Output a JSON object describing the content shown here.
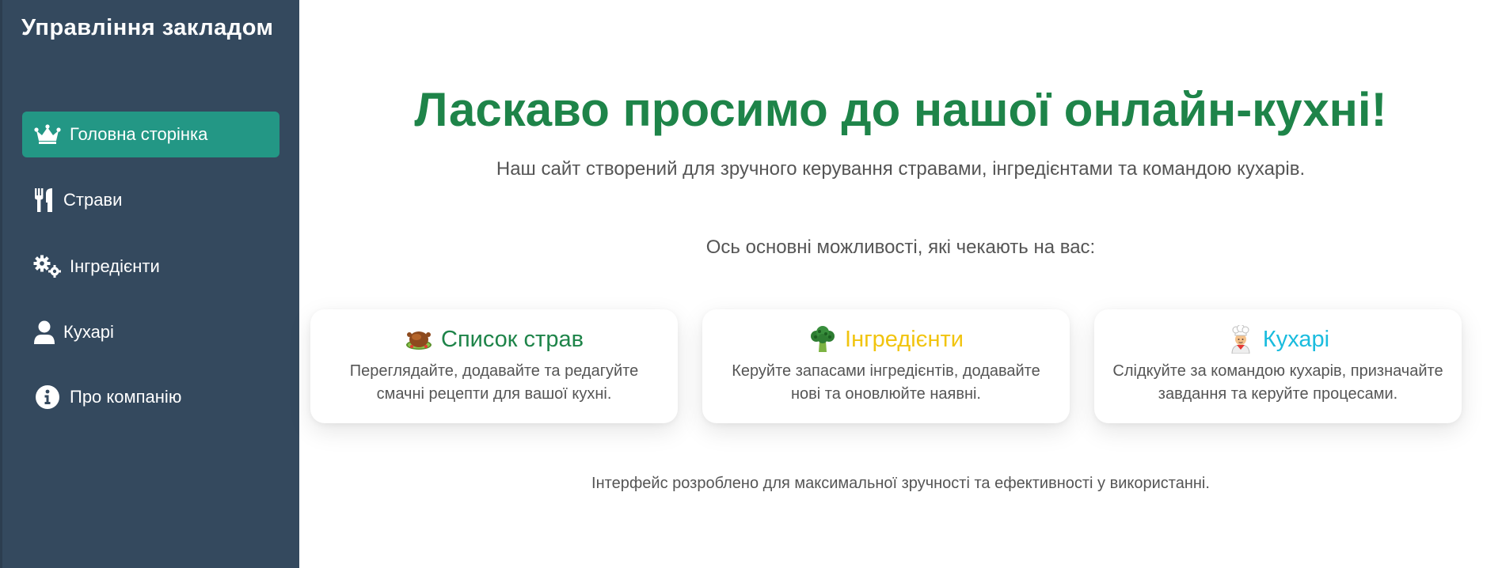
{
  "sidebar": {
    "brand": "Управління закладом",
    "items": [
      {
        "label": "Головна сторінка",
        "icon": "crown-icon",
        "active": true
      },
      {
        "label": "Страви",
        "icon": "utensils-icon"
      },
      {
        "label": "Інгредієнти",
        "icon": "gears-icon"
      },
      {
        "label": "Кухарі",
        "icon": "user-icon"
      },
      {
        "label": "Про компанію",
        "icon": "info-icon"
      }
    ]
  },
  "main": {
    "title": "Ласкаво просимо до нашої онлайн-кухні!",
    "subtitle": "Наш сайт створений для зручного керування стравами, інгредієнтами та командою кухарів.",
    "features_intro": "Ось основні можливості, які чекають на вас:",
    "cards": [
      {
        "title": "Список страв",
        "icon": "roast-chicken-icon",
        "color": "#1e8449",
        "text_line1": "Переглядайте, додавайте та редагуйте",
        "text_line2": "смачні рецепти для вашої кухні."
      },
      {
        "title": "Інгредієнти",
        "icon": "broccoli-icon",
        "color": "#f1c40f",
        "text_line1": "Керуйте запасами інгредієнтів, додавайте",
        "text_line2": "нові та оновлюйте наявні."
      },
      {
        "title": "Кухарі",
        "icon": "chef-icon",
        "color": "#1abcde",
        "text_line1": "Слідкуйте за командою кухарів, призначайте",
        "text_line2": "завдання та керуйте процесами."
      }
    ],
    "footer_note": "Інтерфейс розроблено для максимальної зручності та ефективності у використанні."
  },
  "colors": {
    "sidebar_bg": "#34495e",
    "active_item_bg": "#239785",
    "title_green": "#1e8449",
    "body_text": "#555555"
  }
}
